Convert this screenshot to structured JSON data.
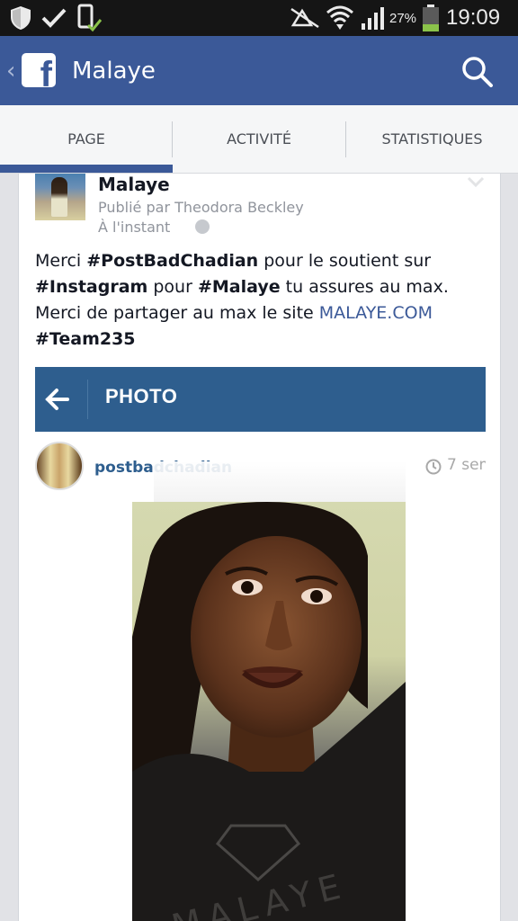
{
  "status_bar": {
    "battery_percent": "27%",
    "time": "19:09"
  },
  "app_bar": {
    "title": "Malaye"
  },
  "tabs": [
    {
      "label": "PAGE",
      "active": true
    },
    {
      "label": "ACTIVITÉ",
      "active": false
    },
    {
      "label": "STATISTIQUES",
      "active": false
    }
  ],
  "post": {
    "page_name": "Malaye",
    "published_by": "Publié par Theodora Beckley",
    "time": "À l'instant",
    "text": {
      "l1_a": "Merci ",
      "l1_b": "#PostBadChadian",
      "l1_c": " pour le soutient sur",
      "l2_a": "#Instagram",
      "l2_b": " pour ",
      "l2_c": "#Malaye",
      "l2_d": " tu assures au max.",
      "l3_a": "Merci de partager au max le site ",
      "l3_link": "MALAYE.COM",
      "l4": "#Team235"
    }
  },
  "embed": {
    "header_title": "PHOTO",
    "username": "postbadchadian",
    "time": "7 sem",
    "shirt_text": "MALAYE"
  },
  "colors": {
    "facebook_blue": "#3b5998",
    "instagram_blue": "#2e5e8e"
  }
}
